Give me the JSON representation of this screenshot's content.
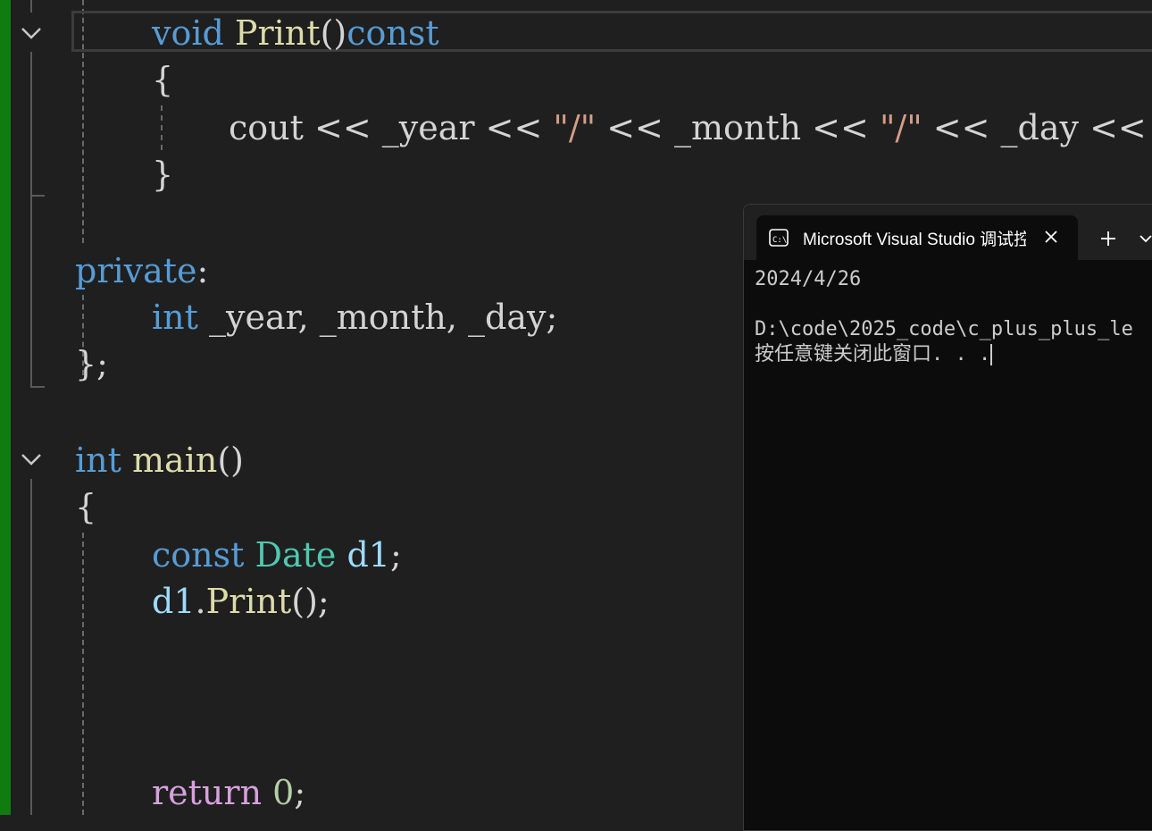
{
  "editor": {
    "lines": [
      {
        "id": "print-decl",
        "tokens": [
          [
            "kw",
            "void"
          ],
          [
            "pl",
            " "
          ],
          [
            "fn",
            "Print"
          ],
          [
            "pl",
            "()"
          ],
          [
            "kw",
            "const"
          ]
        ]
      },
      {
        "id": "open-brace-1",
        "tokens": [
          [
            "pl",
            "{"
          ]
        ]
      },
      {
        "id": "cout-line",
        "tokens": [
          [
            "pl",
            "cout << _year << "
          ],
          [
            "str",
            "\"/\""
          ],
          [
            "pl",
            " << _month << "
          ],
          [
            "str",
            "\"/\""
          ],
          [
            "pl",
            " << _day <<"
          ]
        ]
      },
      {
        "id": "close-brace-1",
        "tokens": [
          [
            "pl",
            "}"
          ]
        ]
      },
      {
        "id": "private-label",
        "tokens": [
          [
            "kw",
            "private"
          ],
          [
            "pl",
            ":"
          ]
        ]
      },
      {
        "id": "member-decl",
        "tokens": [
          [
            "kw",
            "int"
          ],
          [
            "pl",
            " _year, _month, _day;"
          ]
        ]
      },
      {
        "id": "class-end",
        "tokens": [
          [
            "pl",
            "};"
          ]
        ]
      },
      {
        "id": "main-decl",
        "tokens": [
          [
            "kw",
            "int"
          ],
          [
            "pl",
            " "
          ],
          [
            "fn",
            "main"
          ],
          [
            "pl",
            "()"
          ]
        ]
      },
      {
        "id": "open-brace-2",
        "tokens": [
          [
            "pl",
            "{"
          ]
        ]
      },
      {
        "id": "const-decl",
        "tokens": [
          [
            "kw",
            "const"
          ],
          [
            "pl",
            " "
          ],
          [
            "ty",
            "Date"
          ],
          [
            "pl",
            " "
          ],
          [
            "var",
            "d1"
          ],
          [
            "pl",
            ";"
          ]
        ]
      },
      {
        "id": "print-call",
        "tokens": [
          [
            "var",
            "d1"
          ],
          [
            "pl",
            "."
          ],
          [
            "fn",
            "Print"
          ],
          [
            "pl",
            "();"
          ]
        ]
      },
      {
        "id": "return-line",
        "tokens": [
          [
            "ctl",
            "return"
          ],
          [
            "pl",
            " "
          ],
          [
            "num",
            "0"
          ],
          [
            "pl",
            ";"
          ]
        ]
      }
    ]
  },
  "console": {
    "tab_title": "Microsoft Visual Studio 调试控制台",
    "lines": [
      "2024/4/26",
      "",
      "D:\\code\\2025_code\\c_plus_plus_le",
      "按任意键关闭此窗口. . ."
    ]
  },
  "icons": {
    "fold": "chevron-down-icon",
    "terminal": "terminal-icon",
    "close": "close-icon",
    "add": "plus-icon",
    "dropdown": "chevron-down-icon"
  },
  "colors": {
    "editor_bg": "#1f1f1f",
    "change_bar": "#107c10",
    "keyword": "#569cd6",
    "function": "#dcdcaa",
    "type": "#4ec9b0",
    "variable": "#9cdcfe",
    "string": "#d69d85",
    "control": "#d8a0df",
    "number": "#b5cea8",
    "console_bg": "#0c0c0c"
  }
}
